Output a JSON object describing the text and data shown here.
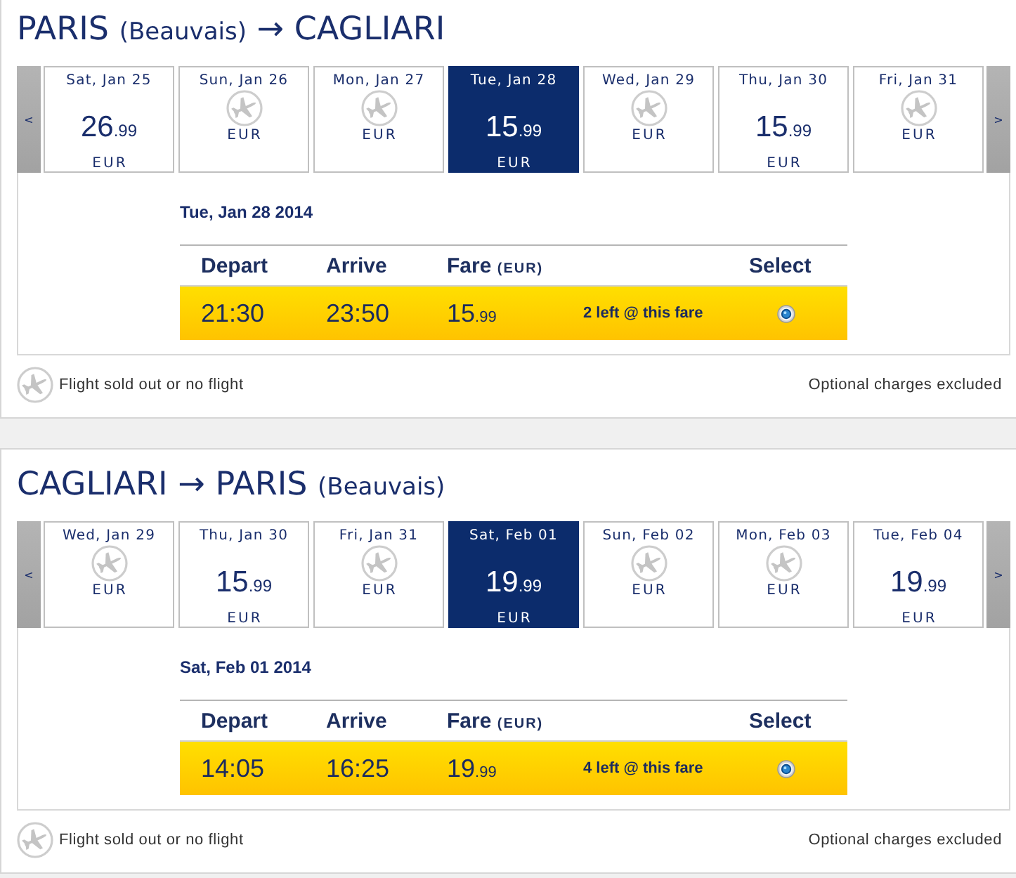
{
  "sections": [
    {
      "title": [
        {
          "kind": "city",
          "text": "PARIS"
        },
        {
          "kind": "airport",
          "text": "(Beauvais)"
        },
        {
          "kind": "arrow",
          "text": "→"
        },
        {
          "kind": "city",
          "text": "CAGLIARI"
        }
      ],
      "prev": "<",
      "next": ">",
      "days": [
        {
          "kind": "fare",
          "label": "Sat, Jan 25",
          "price": "26",
          "cents": ".99",
          "currency": "EUR",
          "selected": false
        },
        {
          "kind": "no_flight",
          "label": "Sun, Jan 26",
          "currency": "EUR",
          "selected": false
        },
        {
          "kind": "no_flight",
          "label": "Mon, Jan 27",
          "currency": "EUR",
          "selected": false
        },
        {
          "kind": "fare",
          "label": "Tue, Jan 28",
          "price": "15",
          "cents": ".99",
          "currency": "EUR",
          "selected": true
        },
        {
          "kind": "no_flight",
          "label": "Wed, Jan 29",
          "currency": "EUR",
          "selected": false
        },
        {
          "kind": "fare",
          "label": "Thu, Jan 30",
          "price": "15",
          "cents": ".99",
          "currency": "EUR",
          "selected": false
        },
        {
          "kind": "no_flight",
          "label": "Fri, Jan 31",
          "currency": "EUR",
          "selected": false
        }
      ],
      "selected_date": "Tue, Jan 28 2014",
      "columns": [
        {
          "kind": "depart",
          "label": "Depart"
        },
        {
          "kind": "arrive",
          "label": "Arrive"
        },
        {
          "kind": "fare",
          "label": "Fare",
          "unit": "(EUR)"
        },
        {
          "kind": "select",
          "label": "Select"
        }
      ],
      "flights": [
        {
          "depart": "21:30",
          "arrive": "23:50",
          "fare": "15",
          "cents": ".99",
          "availability": "2 left @ this fare",
          "selected": true
        }
      ],
      "legend": "Flight sold out or no flight",
      "note": "Optional charges excluded"
    },
    {
      "title": [
        {
          "kind": "city",
          "text": "CAGLIARI"
        },
        {
          "kind": "arrow",
          "text": "→"
        },
        {
          "kind": "city",
          "text": "PARIS"
        },
        {
          "kind": "airport",
          "text": "(Beauvais)"
        }
      ],
      "prev": "<",
      "next": ">",
      "days": [
        {
          "kind": "no_flight",
          "label": "Wed, Jan 29",
          "currency": "EUR",
          "selected": false
        },
        {
          "kind": "fare",
          "label": "Thu, Jan 30",
          "price": "15",
          "cents": ".99",
          "currency": "EUR",
          "selected": false
        },
        {
          "kind": "no_flight",
          "label": "Fri, Jan 31",
          "currency": "EUR",
          "selected": false
        },
        {
          "kind": "fare",
          "label": "Sat, Feb 01",
          "price": "19",
          "cents": ".99",
          "currency": "EUR",
          "selected": true
        },
        {
          "kind": "no_flight",
          "label": "Sun, Feb 02",
          "currency": "EUR",
          "selected": false
        },
        {
          "kind": "no_flight",
          "label": "Mon, Feb 03",
          "currency": "EUR",
          "selected": false
        },
        {
          "kind": "fare",
          "label": "Tue, Feb 04",
          "price": "19",
          "cents": ".99",
          "currency": "EUR",
          "selected": false
        }
      ],
      "selected_date": "Sat, Feb 01 2014",
      "columns": [
        {
          "kind": "depart",
          "label": "Depart"
        },
        {
          "kind": "arrive",
          "label": "Arrive"
        },
        {
          "kind": "fare",
          "label": "Fare",
          "unit": "(EUR)"
        },
        {
          "kind": "select",
          "label": "Select"
        }
      ],
      "flights": [
        {
          "depart": "14:05",
          "arrive": "16:25",
          "fare": "19",
          "cents": ".99",
          "availability": "4 left @ this fare",
          "selected": true
        }
      ],
      "legend": "Flight sold out or no flight",
      "note": "Optional charges excluded"
    }
  ]
}
